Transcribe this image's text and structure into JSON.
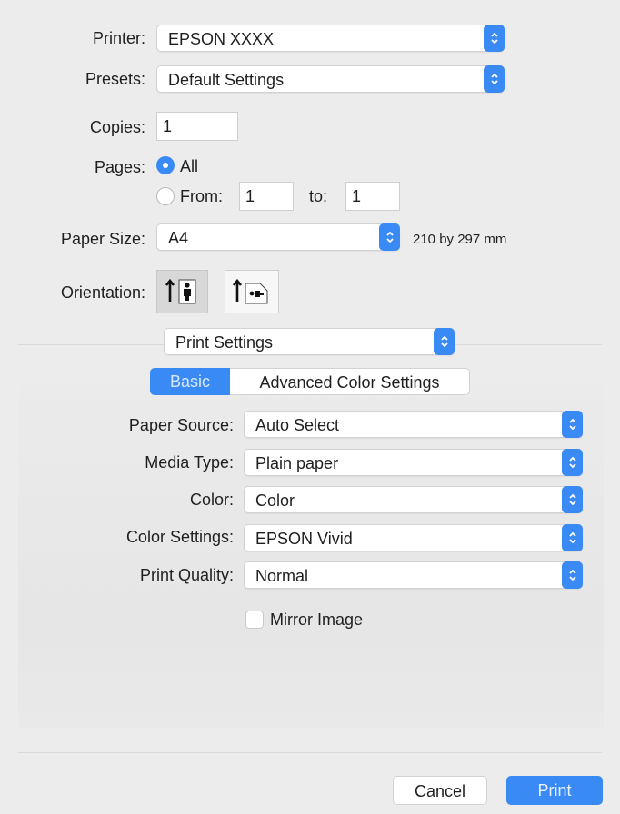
{
  "printer": {
    "label": "Printer:",
    "value": "EPSON XXXX"
  },
  "presets": {
    "label": "Presets:",
    "value": "Default Settings"
  },
  "copies": {
    "label": "Copies:",
    "value": "1"
  },
  "pages": {
    "label": "Pages:",
    "all_label": "All",
    "from_label": "From:",
    "from_value": "1",
    "to_label": "to:",
    "to_value": "1",
    "selected": "All"
  },
  "paper_size": {
    "label": "Paper Size:",
    "value": "A4",
    "dimensions": "210 by 297 mm"
  },
  "orientation": {
    "label": "Orientation:",
    "options": [
      "portrait",
      "landscape"
    ],
    "selected": "portrait"
  },
  "section_popup": {
    "value": "Print Settings"
  },
  "tabs": [
    {
      "label": "Basic",
      "selected": true
    },
    {
      "label": "Advanced Color Settings",
      "selected": false
    }
  ],
  "settings": {
    "paper_source": {
      "label": "Paper Source:",
      "value": "Auto Select"
    },
    "media_type": {
      "label": "Media Type:",
      "value": "Plain paper"
    },
    "color": {
      "label": "Color:",
      "value": "Color"
    },
    "color_settings": {
      "label": "Color Settings:",
      "value": "EPSON Vivid"
    },
    "print_quality": {
      "label": "Print Quality:",
      "value": "Normal"
    },
    "mirror_image": {
      "label": "Mirror Image",
      "checked": false
    }
  },
  "buttons": {
    "cancel": "Cancel",
    "print": "Print"
  },
  "colors": {
    "accent": "#3a8af5",
    "background": "#ececec"
  }
}
